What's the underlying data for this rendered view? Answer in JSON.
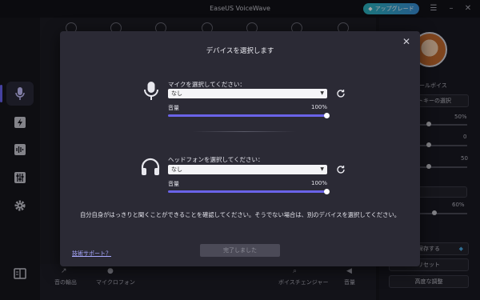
{
  "app": {
    "title": "EaseUS VoiceWave",
    "upgrade_label": "アップグレード",
    "menu_icon": "hamburger-icon",
    "minimize_icon": "minimize-icon",
    "close_icon": "close-icon"
  },
  "nav": {
    "items": [
      {
        "name": "microphone-voice",
        "icon": "mic-icon"
      },
      {
        "name": "soundboard",
        "icon": "lightning-icon"
      },
      {
        "name": "recording",
        "icon": "waveform-icon"
      },
      {
        "name": "equalizer",
        "icon": "sliders-icon"
      },
      {
        "name": "settings",
        "icon": "gear-icon"
      },
      {
        "name": "tutorial",
        "icon": "book-icon"
      }
    ]
  },
  "background": {
    "bottom_bar": {
      "export_label": "音の輸出",
      "mic_label": "マイクロフォン",
      "voice_changer_label": "ボイスチェンジャー",
      "volume_label": "音量"
    },
    "right_panel": {
      "voice_name": "ールボイス",
      "hotkey_button": "ットキーの選択",
      "slider1_value": "50%",
      "slider2_value": "0",
      "slider3_value": "50",
      "slider4_value": "60%",
      "save_button": "を保存する",
      "reset_button": "リセット",
      "advanced_button": "高度な調整"
    }
  },
  "dialog": {
    "title": "デバイスを選択します",
    "mic": {
      "label": "マイクを選択してください：",
      "selected": "なし",
      "volume_label": "音量",
      "volume_pct": "100%",
      "volume_value": 1.0
    },
    "headphone": {
      "label": "ヘッドフォンを選択してください：",
      "selected": "なし",
      "volume_label": "音量",
      "volume_pct": "100%",
      "volume_value": 1.0
    },
    "notice": "自分自身がはっきりと聞くことができることを確認してください。そうでない場合は、別のデバイスを選択してください。",
    "support_link": "技術サポート？",
    "done_button": "完了しました"
  },
  "colors": {
    "accent": "#6a63e8",
    "dialog_bg": "#2b2a35"
  }
}
